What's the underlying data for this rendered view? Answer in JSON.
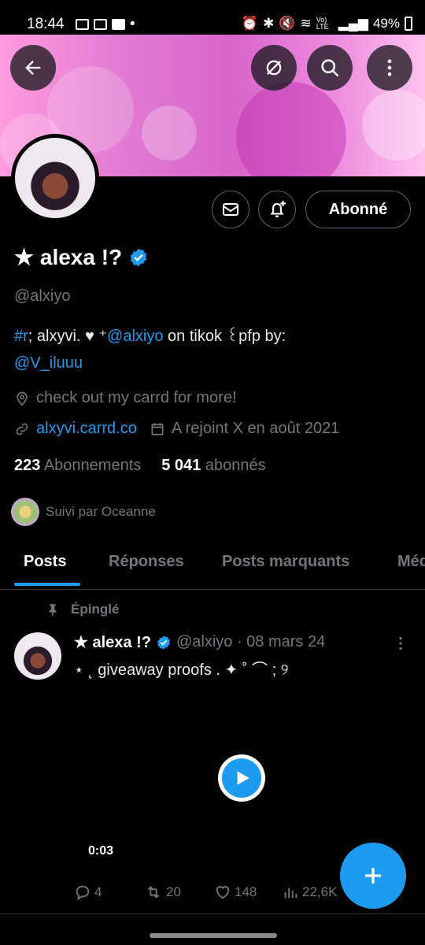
{
  "status_bar": {
    "time": "18:44",
    "dot": "•",
    "signal": "Vo) LTE",
    "battery": "49%"
  },
  "profile": {
    "name": "★ alexa !?",
    "handle": "@alxiyo",
    "bio": {
      "hashtag": "#r",
      "part1": "; alxyvi.    ♥    ⁺",
      "mention1": "@alxiyo",
      "part2": " on tikok ꒰pfp by:",
      "mention2": "@V_iluuu"
    },
    "location": "check out my carrd for more!",
    "link": "alxyvi.carrd.co",
    "joined": "A rejoint X en août 2021",
    "following_count": "223",
    "following_label": "Abonnements",
    "followers_count": "5 041",
    "followers_label": "abonnés",
    "followed_by": "Suivi par Oceanne",
    "follow_button": "Abonné"
  },
  "tabs": [
    "Posts",
    "Réponses",
    "Posts marquants",
    "Méd"
  ],
  "post": {
    "pinned_label": "Épinglé",
    "author": "★ alexa !?",
    "meta": "@alxiyo · 08 mars 24",
    "text": "⋆  ˛      giveaway proofs   . ✦ ˚ ⌒ ; ୨",
    "duration": "0:03",
    "replies": "4",
    "reposts": "20",
    "likes": "148",
    "views": "22,6K"
  },
  "colors": {
    "accent": "#1d9bf0",
    "muted": "#71767b",
    "banner": "#e07ad3"
  },
  "icons": [
    "back-arrow-icon",
    "hide-icon",
    "search-icon",
    "more-vertical-icon",
    "mail-icon",
    "bell-plus-icon",
    "verified-icon",
    "location-icon",
    "link-icon",
    "calendar-icon",
    "pin-icon",
    "play-icon",
    "reply-icon",
    "repost-icon",
    "like-icon",
    "views-icon",
    "plus-icon"
  ]
}
